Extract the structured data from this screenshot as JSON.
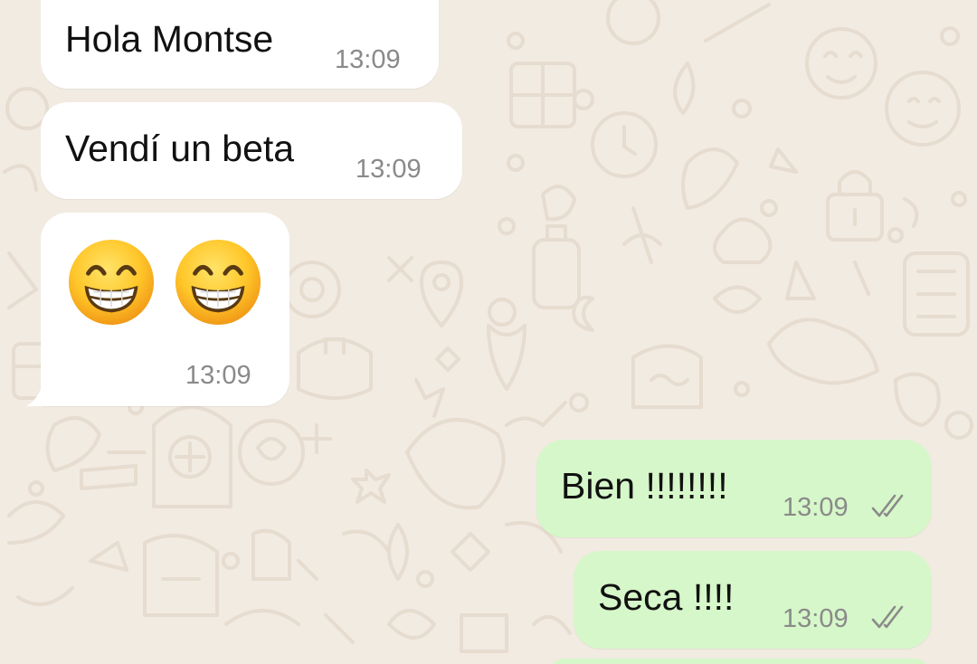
{
  "chat": {
    "messages": [
      {
        "direction": "incoming",
        "text": "Hola Montse",
        "time": "13:09"
      },
      {
        "direction": "incoming",
        "text": "Vendí un beta",
        "time": "13:09"
      },
      {
        "direction": "incoming",
        "emoji": [
          "grinning-face-with-smiling-eyes",
          "grinning-face-with-smiling-eyes"
        ],
        "time": "13:09"
      },
      {
        "direction": "outgoing",
        "text": "Bien !!!!!!!!",
        "time": "13:09",
        "status": "double-check-read-icon"
      },
      {
        "direction": "outgoing",
        "text": "Seca !!!!",
        "time": "13:09",
        "status": "double-check-read-icon"
      }
    ]
  },
  "colors": {
    "background": "#f2ebe2",
    "incoming_bubble": "#ffffff",
    "outgoing_bubble": "#d6f7c9",
    "text": "#111111",
    "meta": "#8a8a8a"
  }
}
